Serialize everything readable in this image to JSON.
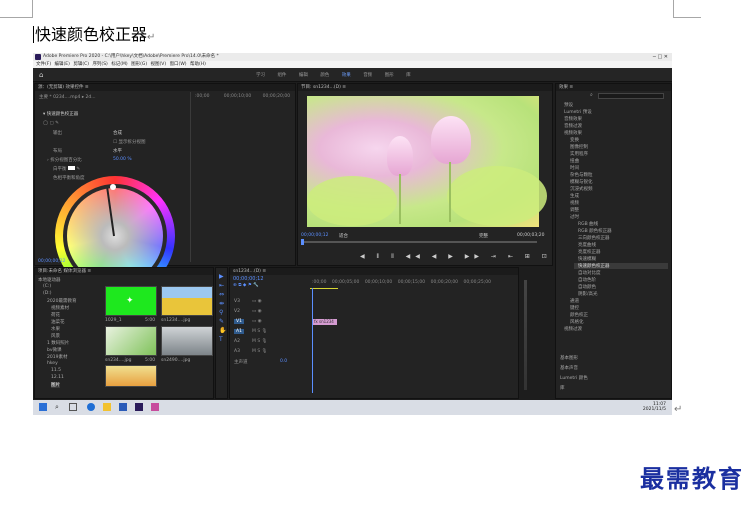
{
  "document": {
    "heading": "快速颜色校正器",
    "paragraph_mark": "↵",
    "watermark": "最需教育"
  },
  "window": {
    "title": "Adobe Premiere Pro 2020 - C:\\用户\\hkey\\文档\\Adobe\\Premiere Pro\\14.0\\未命名 *",
    "controls": "─  □  ✕"
  },
  "menu": {
    "items": [
      "文件(F)",
      "编辑(E)",
      "剪辑(C)",
      "序列(S)",
      "标记(M)",
      "图形(G)",
      "视图(V)",
      "窗口(W)",
      "帮助(H)"
    ]
  },
  "workspace": {
    "tabs": [
      "学习",
      "组件",
      "编辑",
      "颜色",
      "效果",
      "音频",
      "图形",
      "库"
    ],
    "active_tab": "效果"
  },
  "effect_controls": {
    "header_tabs": "源：(无剪辑)   效果控件 ≡",
    "clip_row": "主要 * 0234....mp4 ▸ 2d...",
    "section": "快速颜色校正器",
    "output_label": "输出",
    "output_value": "合成",
    "show_split": "显示拆分视图",
    "layout_label": "布局",
    "layout_value": "水平",
    "split_percent_label": "拆分视图百分比",
    "split_percent_value": "50.00 %",
    "white_balance_label": "白平衡",
    "hue_balance_label": "色相平衡和角度",
    "time_value": "00;00;00;12"
  },
  "program_monitor": {
    "header": "节目: sn1234...(D) ≡",
    "timecode_left": "00;00;00;12",
    "fit_label": "适合",
    "quality": "完整",
    "timecode_right": "00;00;03;20",
    "controls": "◀  ⦀  ⦀  ◀◀  ◀  ▶  ▶▶  ⇥  ⇤  ⊞  ⊡  ⊙"
  },
  "effects_panel": {
    "header": "效果 ≡",
    "items": [
      "预设",
      "Lumetri 预设",
      "音频效果",
      "音频过渡",
      "视频效果",
      "变换",
      "图像控制",
      "实用程序",
      "扭曲",
      "时间",
      "杂色与颗粒",
      "模糊与锐化",
      "沉浸式视频",
      "生成",
      "视频",
      "调整",
      "过时",
      "RGB 曲线",
      "RGB 颜色校正器",
      "三向颜色校正器",
      "亮度曲线",
      "亮度校正器",
      "快速模糊",
      "快速颜色校正器",
      "自动对比度",
      "自动色阶",
      "自动颜色",
      "阴影/高光",
      "通道",
      "键控",
      "颜色校正",
      "风格化",
      "视频过渡"
    ],
    "footer_items": [
      "基本图形",
      "基本声音",
      "Lumetri 颜色",
      "库"
    ]
  },
  "project_panel": {
    "header": "项目:未命名   媒体浏览器 ≡",
    "tree": [
      "本地驱动器",
      "(C:)",
      "(D:)",
      "(E:)",
      "(F:)",
      "2020最需教育",
      "视频素材",
      "荷花",
      "油菜花",
      "水果",
      "风景",
      "1 数码照片",
      "bv微课",
      "2019素材",
      "hkey",
      "11.5",
      "12.11",
      "图片"
    ],
    "thumb_labels": [
      "1029_1",
      "sn1234....jpg",
      "sn234....jpg",
      "sn2490....jpg"
    ],
    "thumb_durations": [
      "5:00",
      "5:00",
      "5:00",
      ""
    ]
  },
  "timeline": {
    "header": "sn1234...(D) ≡",
    "timecode": "00;00;00;12",
    "ruler": [
      ":00;00",
      "00;00;05;00",
      "00;00;10;00",
      "00;00;15;00",
      "00;00;20;00",
      "00;00;25;00",
      "00;00;30;00",
      "00;00;35;00"
    ],
    "tracks": [
      "V3",
      "V2",
      "V1",
      "A1",
      "A2",
      "A3",
      "主声道"
    ],
    "master_value": "0.0",
    "clip_label": "fx sn1234"
  },
  "taskbar": {
    "time": "11:07",
    "date": "2021/11/5"
  }
}
